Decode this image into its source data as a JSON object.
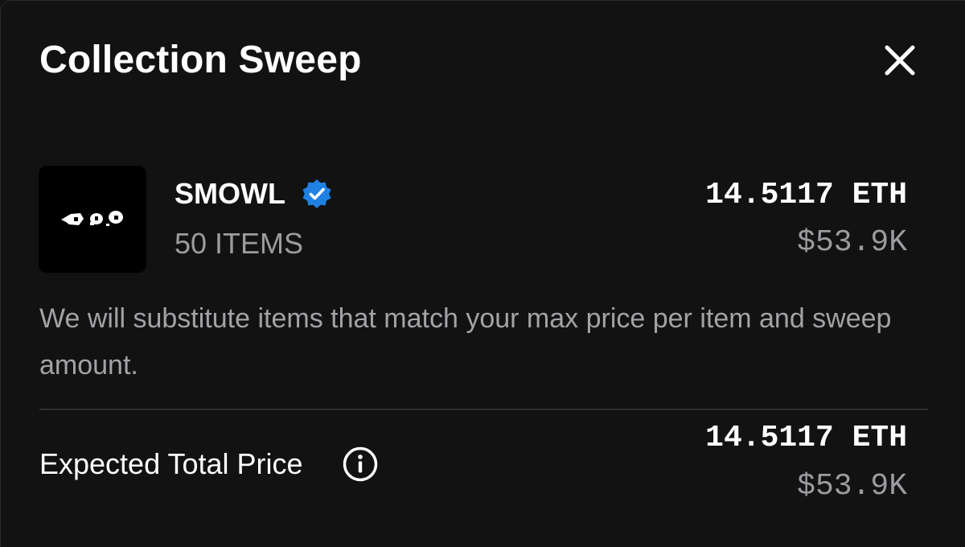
{
  "modal": {
    "title": "Collection Sweep",
    "close_icon": "close-icon"
  },
  "collection": {
    "name": "SMOWL",
    "verified_icon": "verified-badge-icon",
    "verified_color": "#2081e2",
    "item_count": "50 ITEMS",
    "price_eth": "14.5117 ETH",
    "price_usd": "$53.9K"
  },
  "note": "We will substitute items that match your max price per item and sweep amount.",
  "total": {
    "label": "Expected Total Price",
    "info_icon": "info-icon",
    "price_eth": "14.5117 ETH",
    "price_usd": "$53.9K"
  }
}
